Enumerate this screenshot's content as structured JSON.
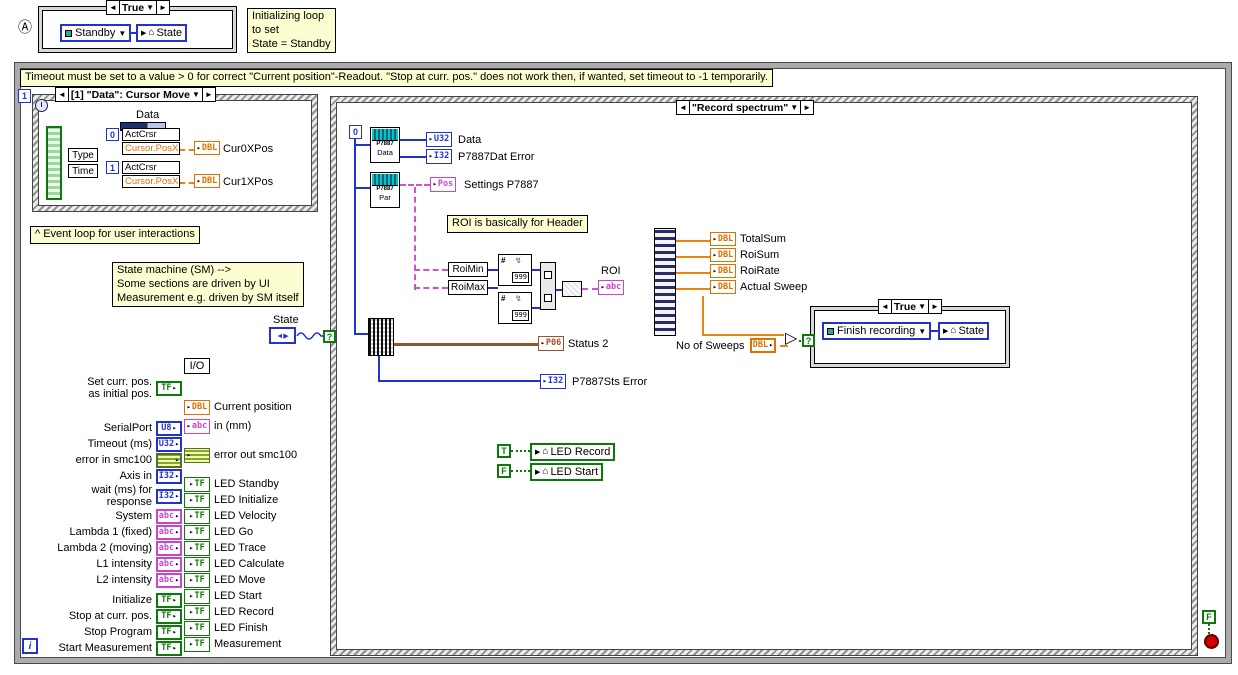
{
  "marker_a": "Ⓐ",
  "init_case": {
    "selector": "True",
    "enum_value": "Standby",
    "local_label": "State",
    "comment": "Initializing loop\nto set\nState = Standby"
  },
  "while_loop": {
    "timeout_comment": "Timeout must be set to a value > 0 for correct \"Current position\"-Readout. \"Stop at curr. pos.\" does not work then, if wanted, set timeout to -1 temporarily.",
    "event_number": "1",
    "iteration_label": "i",
    "stop_const": "F"
  },
  "event_structure": {
    "selector": "[1] \"Data\": Cursor Move",
    "data_label": "Data",
    "field1": "Type",
    "field2": "Time",
    "rows": [
      {
        "index": "0",
        "prop": "ActCrsr",
        "subprop": "Cursor.PosX",
        "out_type": "DBL",
        "out_label": "Cur0XPos"
      },
      {
        "index": "1",
        "prop": "ActCrsr",
        "subprop": "Cursor.PosX",
        "out_type": "DBL",
        "out_label": "Cur1XPos"
      }
    ],
    "footer_comment": "^ Event loop for user interactions"
  },
  "sm_comment": "State machine (SM) -->\nSome sections are driven by UI\nMeasurement e.g. driven by SM itself",
  "state_terminal_label": "State",
  "io_title": "I/O",
  "io_inputs": [
    {
      "label": "Set curr. pos.\nas initial pos.",
      "type": "TF"
    },
    {
      "label": "SerialPort",
      "type": "U8"
    },
    {
      "label": "Timeout (ms)",
      "type": "U32"
    },
    {
      "label": "error in smc100",
      "type": "err"
    },
    {
      "label": "Axis in",
      "type": "I32"
    },
    {
      "label": "wait (ms) for\nresponse",
      "type": "I32"
    },
    {
      "label": "System",
      "type": "abc"
    },
    {
      "label": "Lambda 1 (fixed)",
      "type": "abc"
    },
    {
      "label": "Lambda 2 (moving)",
      "type": "abc"
    },
    {
      "label": "L1 intensity",
      "type": "abc"
    },
    {
      "label": "L2 intensity",
      "type": "abc"
    },
    {
      "label": "Initialize",
      "type": "TF"
    },
    {
      "label": "Stop at curr. pos.",
      "type": "TF"
    },
    {
      "label": "Stop Program",
      "type": "TF"
    },
    {
      "label": "Start Measurement",
      "type": "TF"
    }
  ],
  "io_outputs": [
    {
      "label": "Current position",
      "type": "DBL"
    },
    {
      "label": "in (mm)",
      "type": "abc"
    },
    {
      "label": "error out smc100",
      "type": "err"
    },
    {
      "label": "LED Standby",
      "type": "TF"
    },
    {
      "label": "LED Initialize",
      "type": "TF"
    },
    {
      "label": "LED Velocity",
      "type": "TF"
    },
    {
      "label": "LED Go",
      "type": "TF"
    },
    {
      "label": "LED Trace",
      "type": "TF"
    },
    {
      "label": "LED Calculate",
      "type": "TF"
    },
    {
      "label": "LED Move",
      "type": "TF"
    },
    {
      "label": "LED Start",
      "type": "TF"
    },
    {
      "label": "LED Record",
      "type": "TF"
    },
    {
      "label": "LED Finish",
      "type": "TF"
    },
    {
      "label": "Measurement",
      "type": "TF"
    }
  ],
  "record_case": {
    "selector": "\"Record spectrum\"",
    "zero_const": "0",
    "data_vi": {
      "line1": "P7887",
      "line2": "Data"
    },
    "par_vi": {
      "line1": "P7887",
      "line2": "Par"
    },
    "out_data": {
      "type": "U32",
      "label": "Data"
    },
    "out_dat_error": {
      "type": "I32",
      "label": "P7887Dat Error"
    },
    "out_settings": {
      "type": "Pos",
      "label": "Settings P7887"
    },
    "roi_comment": "ROI is basically for Header",
    "roi_min": "RoiMin",
    "roi_max": "RoiMax",
    "range_symbol": "#",
    "range_limit": "999",
    "roi_out": {
      "type": "abc",
      "label": "ROI"
    },
    "sums": [
      {
        "type": "DBL",
        "label": "TotalSum"
      },
      {
        "type": "DBL",
        "label": "RoiSum"
      },
      {
        "type": "DBL",
        "label": "RoiRate"
      },
      {
        "type": "DBL",
        "label": "Actual Sweep"
      }
    ],
    "status2": {
      "type": "P06",
      "label": "Status 2"
    },
    "sts_error": {
      "type": "I32",
      "label": "P7887Sts Error"
    },
    "no_of_sweeps": {
      "label": "No of Sweeps",
      "type": "DBL"
    },
    "finish_case": {
      "selector": "True",
      "enum_value": "Finish recording",
      "local_label": "State"
    },
    "true_const": "T",
    "false_const": "F",
    "led_record_local": "LED Record",
    "led_start_local": "LED Start"
  }
}
